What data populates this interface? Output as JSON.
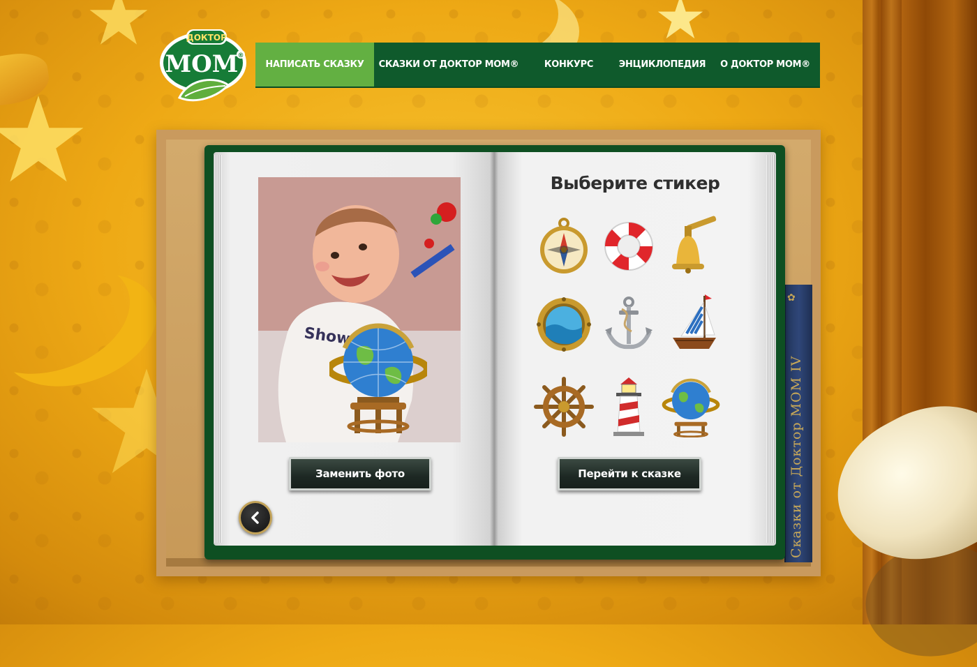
{
  "brand": {
    "logo_top": "ДОКТОР",
    "logo_main": "МОМ"
  },
  "nav": {
    "items": [
      {
        "label": "НАПИСАТЬ СКАЗКУ",
        "active": true
      },
      {
        "label": "СКАЗКИ ОТ ДОКТОР МОМ®",
        "active": false
      },
      {
        "label": "КОНКУРС",
        "active": false
      },
      {
        "label": "ЭНЦИКЛОПЕДИЯ",
        "active": false
      },
      {
        "label": "О ДОКТОР МОМ®",
        "active": false
      }
    ]
  },
  "book": {
    "left_page": {
      "photo_alt": "baby-photo",
      "applied_sticker": "globe-icon",
      "replace_button": "Заменить фото",
      "back_icon": "chevron-left-icon"
    },
    "right_page": {
      "title": "Выберите стикер",
      "stickers": [
        "compass-icon",
        "lifebuoy-icon",
        "ship-bell-icon",
        "porthole-icon",
        "anchor-icon",
        "sailboat-icon",
        "ship-wheel-icon",
        "lighthouse-icon",
        "globe-icon"
      ],
      "continue_button": "Перейти к сказке"
    }
  },
  "shelf_book": {
    "spine_title": "Сказки от Доктор МОМ IV"
  },
  "colors": {
    "nav_bg": "#0f5a2c",
    "nav_active": "#63b042",
    "book_cover": "#0e4f22",
    "background": "#eea915"
  }
}
